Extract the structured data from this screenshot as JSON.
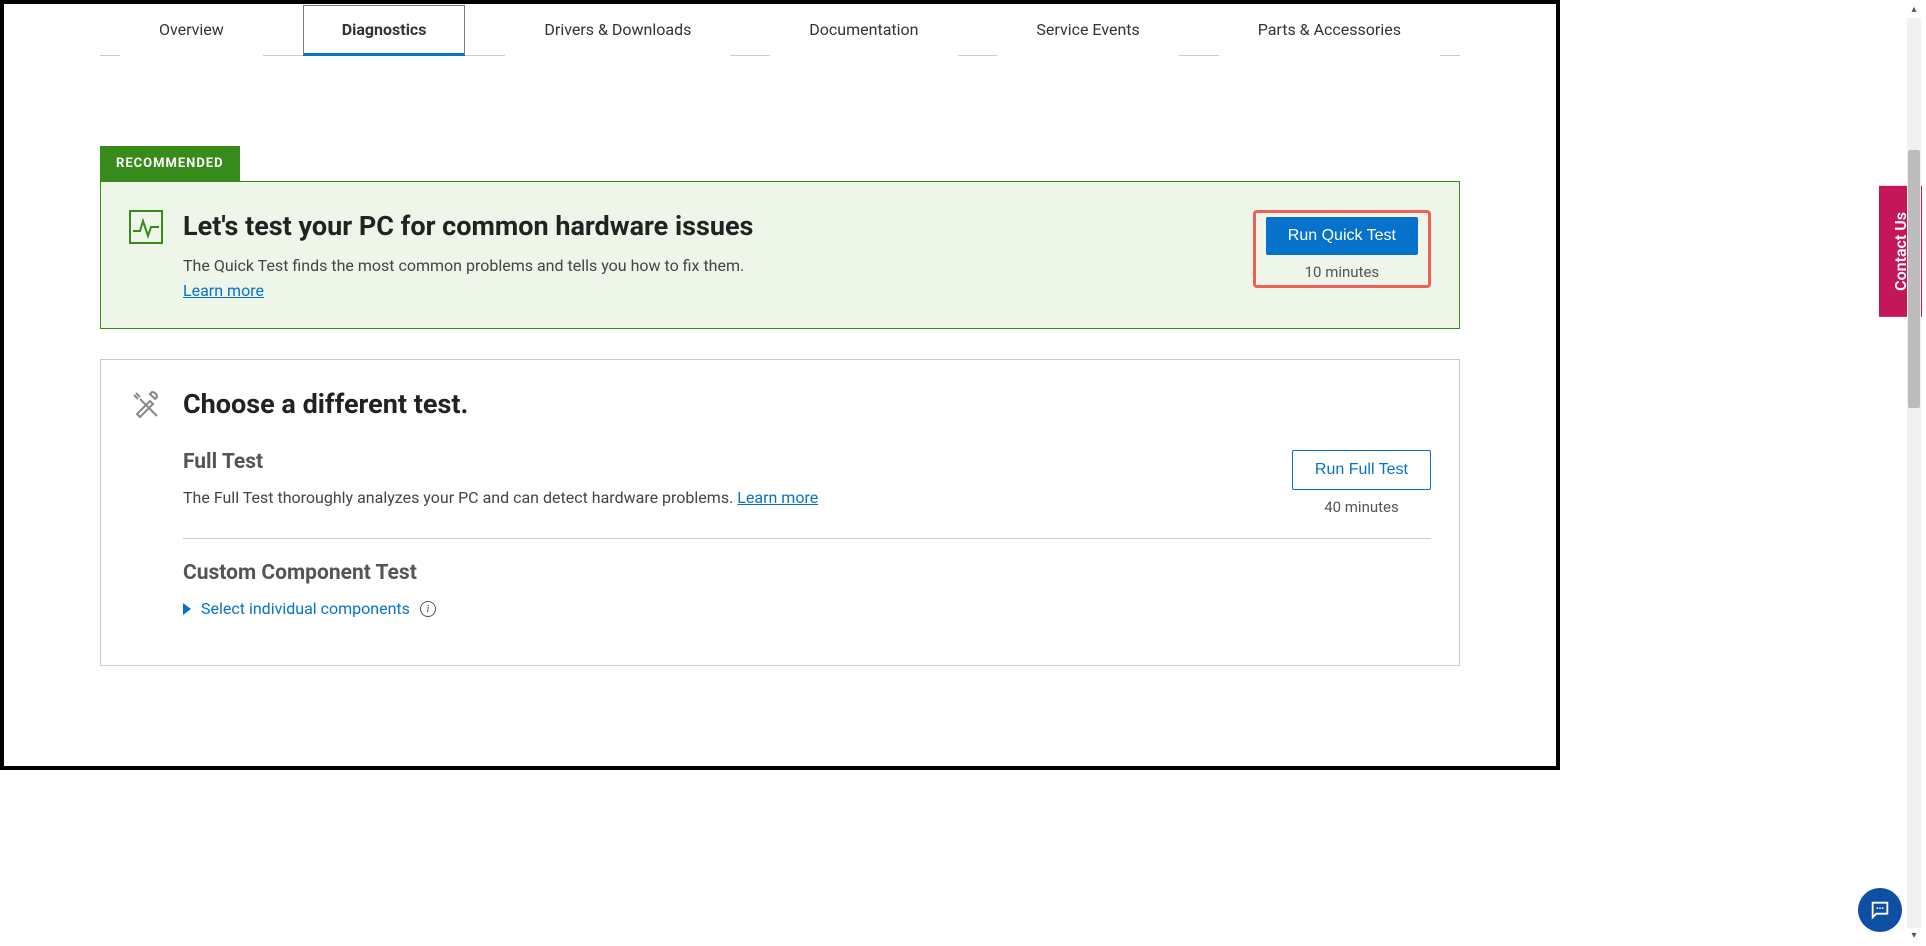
{
  "tabs": {
    "overview": "Overview",
    "diagnostics": "Diagnostics",
    "drivers": "Drivers & Downloads",
    "documentation": "Documentation",
    "service": "Service Events",
    "parts": "Parts & Accessories"
  },
  "recommended": {
    "badge": "RECOMMENDED",
    "title": "Let's test your PC for common hardware issues",
    "desc": "The Quick Test finds the most common problems and tells you how to fix them.",
    "learn_more": "Learn more",
    "button": "Run Quick Test",
    "time": "10 minutes"
  },
  "other": {
    "title": "Choose a different test.",
    "full": {
      "name": "Full Test",
      "desc": "The Full Test thoroughly analyzes your PC and can detect hardware problems. ",
      "learn_more": "Learn more",
      "button": "Run Full Test",
      "time": "40 minutes"
    },
    "custom": {
      "name": "Custom Component Test",
      "select_label": "Select individual components"
    }
  },
  "contact": {
    "label": "Contact Us"
  }
}
